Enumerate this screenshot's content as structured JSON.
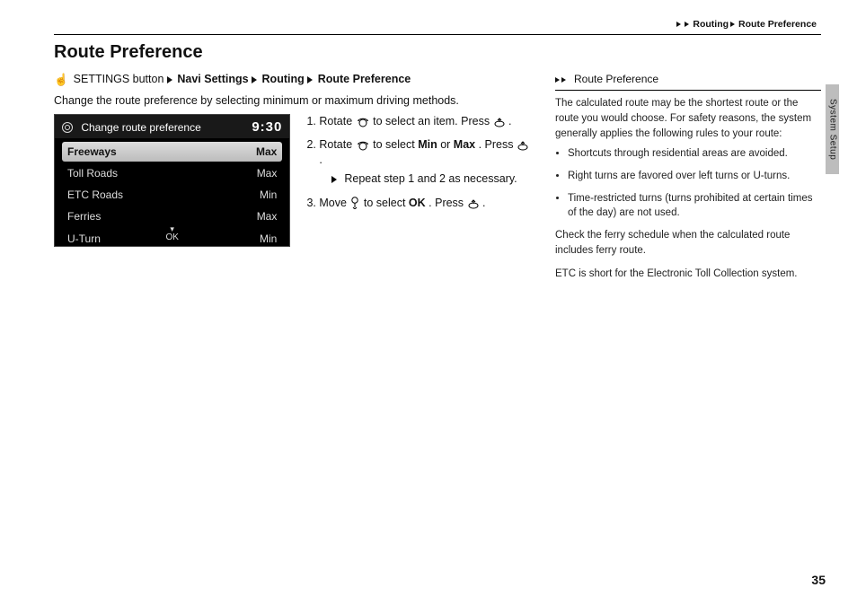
{
  "header": {
    "crumb1": "Routing",
    "crumb2": "Route Preference"
  },
  "title": "Route Preference",
  "nav": {
    "btn": "SETTINGS button",
    "a": "Navi Settings",
    "b": "Routing",
    "c": "Route Preference"
  },
  "intro": "Change the route preference by selecting minimum or maximum driving methods.",
  "screenshot": {
    "title": "Change route preference",
    "clock": "9:30",
    "rows": [
      {
        "label": "Freeways",
        "val": "Max",
        "selected": true
      },
      {
        "label": "Toll Roads",
        "val": "Max",
        "selected": false
      },
      {
        "label": "ETC Roads",
        "val": "Min",
        "selected": false
      },
      {
        "label": "Ferries",
        "val": "Max",
        "selected": false
      },
      {
        "label": "U-Turn",
        "val": "Min",
        "selected": false
      }
    ],
    "ok": "OK"
  },
  "steps": {
    "s1a": "Rotate ",
    "s1b": " to select an item. Press ",
    "s1c": ".",
    "s2a": "Rotate ",
    "s2b": " to select ",
    "s2min": "Min",
    "s2or": " or ",
    "s2max": "Max",
    "s2c": ". Press ",
    "s2d": ".",
    "s2sub_marker": "▶",
    "s2sub": "Repeat step 1 and 2 as necessary.",
    "s3a": "Move ",
    "s3b": " to select ",
    "s3ok": "OK",
    "s3c": ". Press ",
    "s3d": "."
  },
  "side": {
    "title": "Route Preference",
    "p1": "The calculated route may be the shortest route or the route you would choose. For safety reasons, the system generally applies the following rules to your route:",
    "b1": "Shortcuts through residential areas are avoided.",
    "b2": "Right turns are favored over left turns or U-turns.",
    "b3": "Time-restricted turns (turns prohibited at certain times of the day) are not used.",
    "p2": "Check the ferry schedule when the calculated route includes ferry route.",
    "p3": "ETC is short for the Electronic Toll Collection system."
  },
  "tab": "System Setup",
  "page": "35"
}
